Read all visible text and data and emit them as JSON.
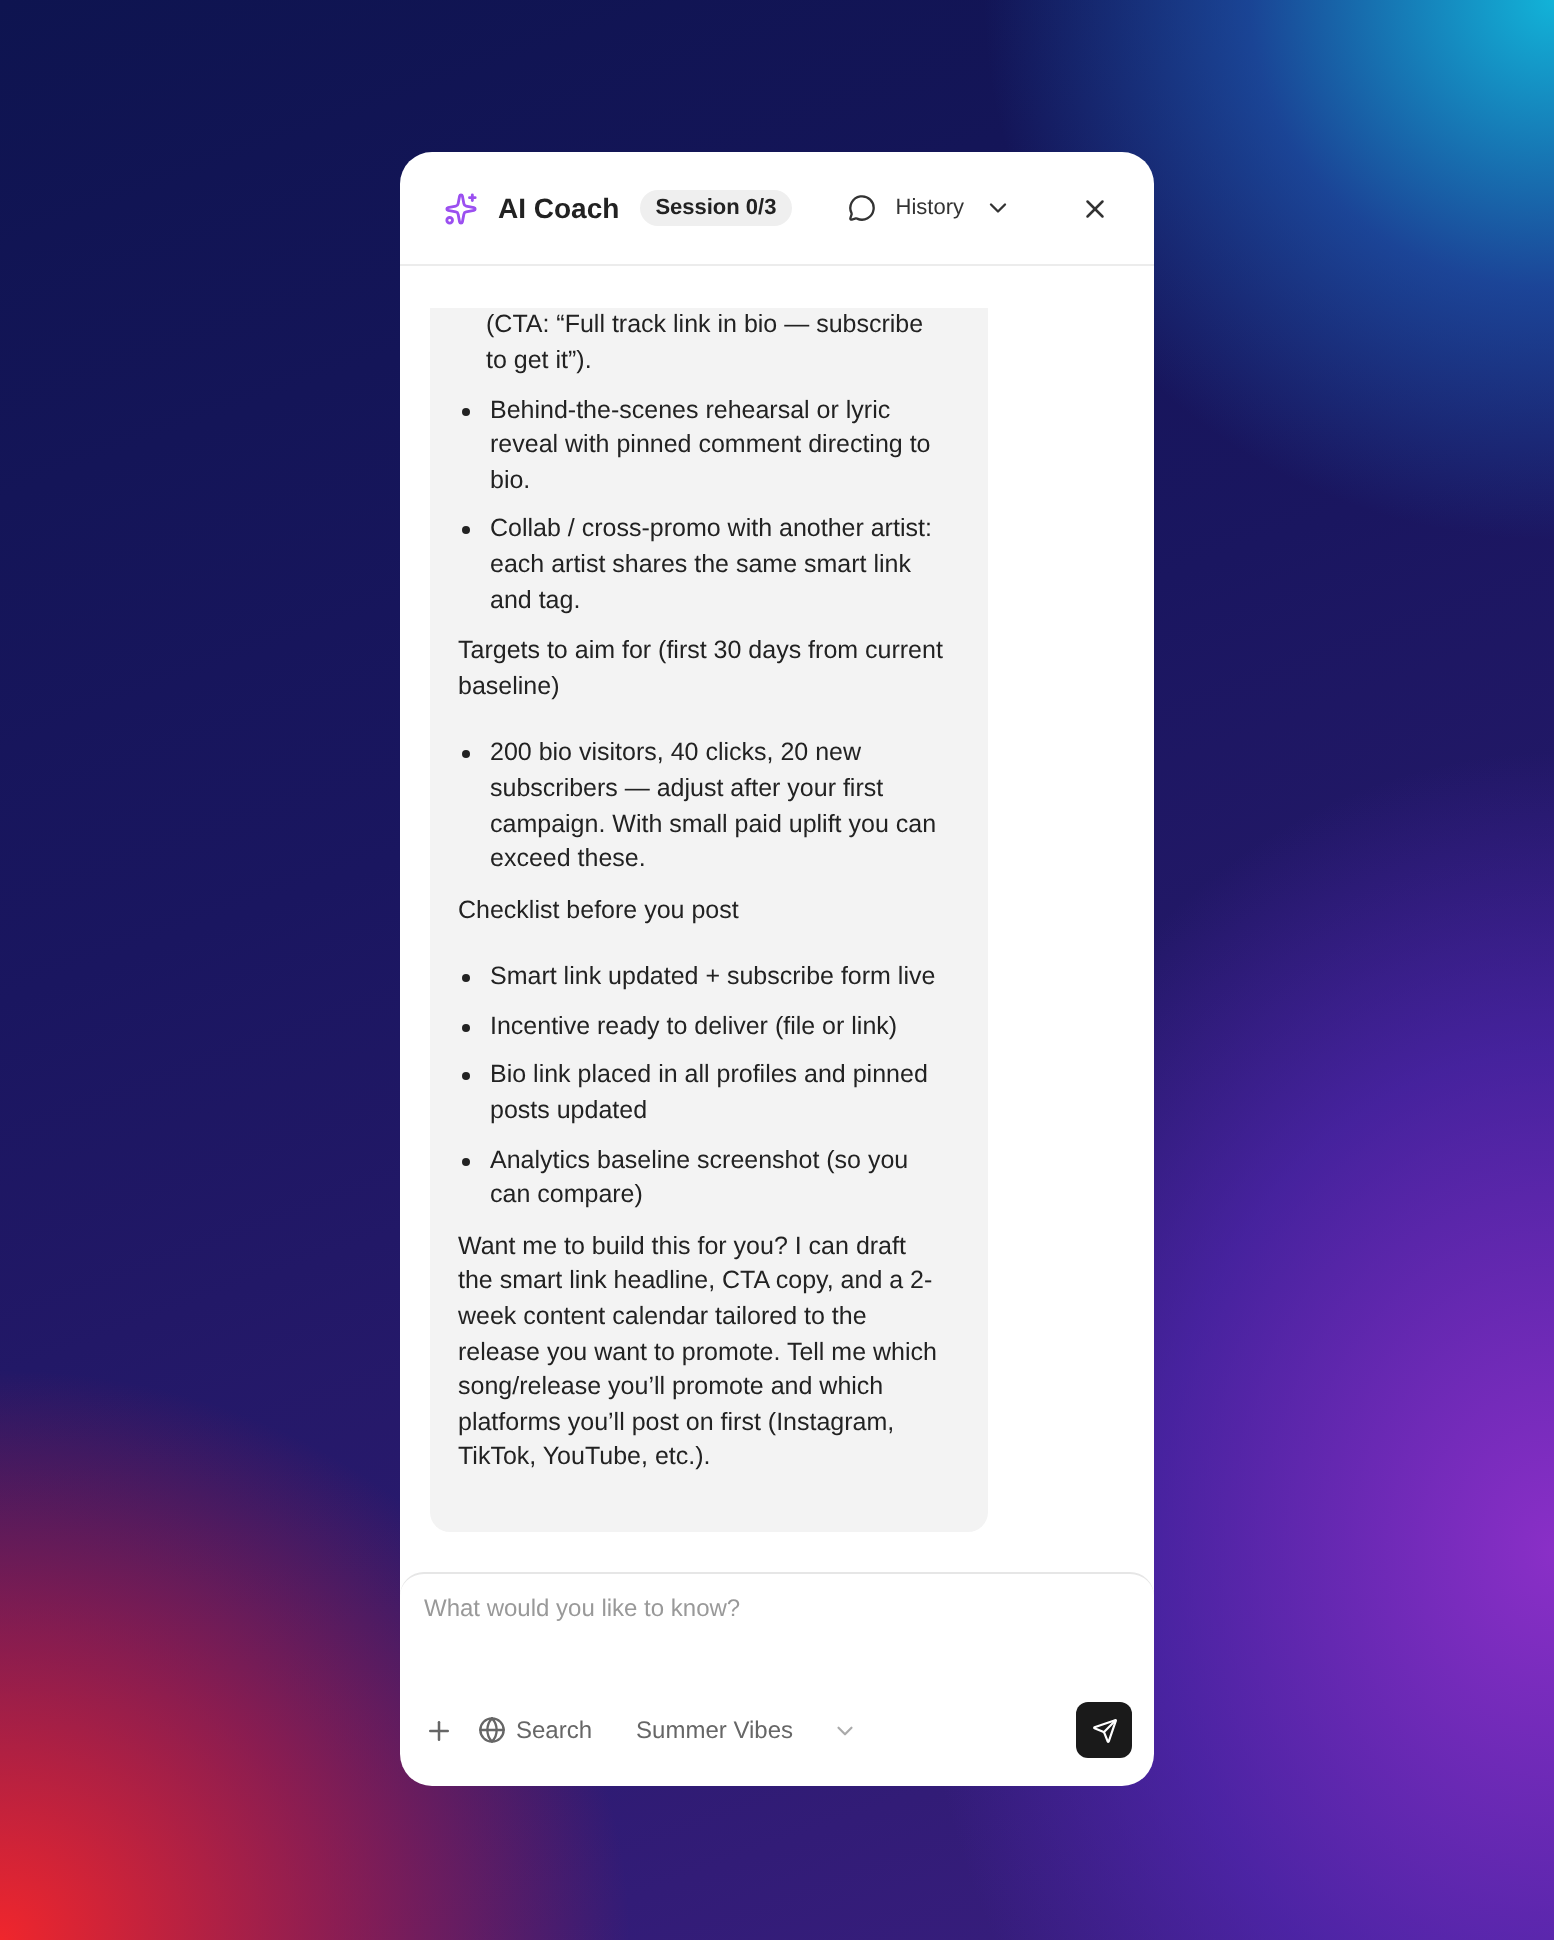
{
  "header": {
    "title": "AI Coach",
    "session": "Session 0/3",
    "history": "History"
  },
  "message": [
    {
      "kind": "continued",
      "text": "(CTA: “Full track link in bio — subscribe to get it”)."
    },
    {
      "kind": "bullet",
      "text": "Behind-the-scenes rehearsal or lyric reveal with pinned comment directing to bio."
    },
    {
      "kind": "bullet",
      "text": "Collab / cross-promo with another artist: each artist shares the same smart link and tag."
    },
    {
      "kind": "paragraph",
      "text": "Targets to aim for (first 30 days from current baseline)"
    },
    {
      "kind": "bullet",
      "text": "200 bio visitors, 40 clicks, 20 new subscribers — adjust after your first campaign. With small paid uplift you can exceed these."
    },
    {
      "kind": "paragraph",
      "text": "Checklist before you post"
    },
    {
      "kind": "bullet",
      "text": "Smart link updated + subscribe form live"
    },
    {
      "kind": "bullet",
      "text": "Incentive ready to deliver (file or link)"
    },
    {
      "kind": "bullet",
      "text": "Bio link placed in all profiles and pinned posts updated"
    },
    {
      "kind": "bullet",
      "text": "Analytics baseline screenshot (so you can compare)"
    },
    {
      "kind": "paragraph",
      "text": "Want me to build this for you? I can draft the smart link headline, CTA copy, and a 2-week content calendar tailored to the release you want to promote. Tell me which song/release you’ll promote and which platforms you’ll post on first (Instagram, TikTok, YouTube, etc.)."
    }
  ],
  "composer": {
    "placeholder": "What would you like to know?",
    "search": "Search",
    "project": "Summer Vibes"
  }
}
